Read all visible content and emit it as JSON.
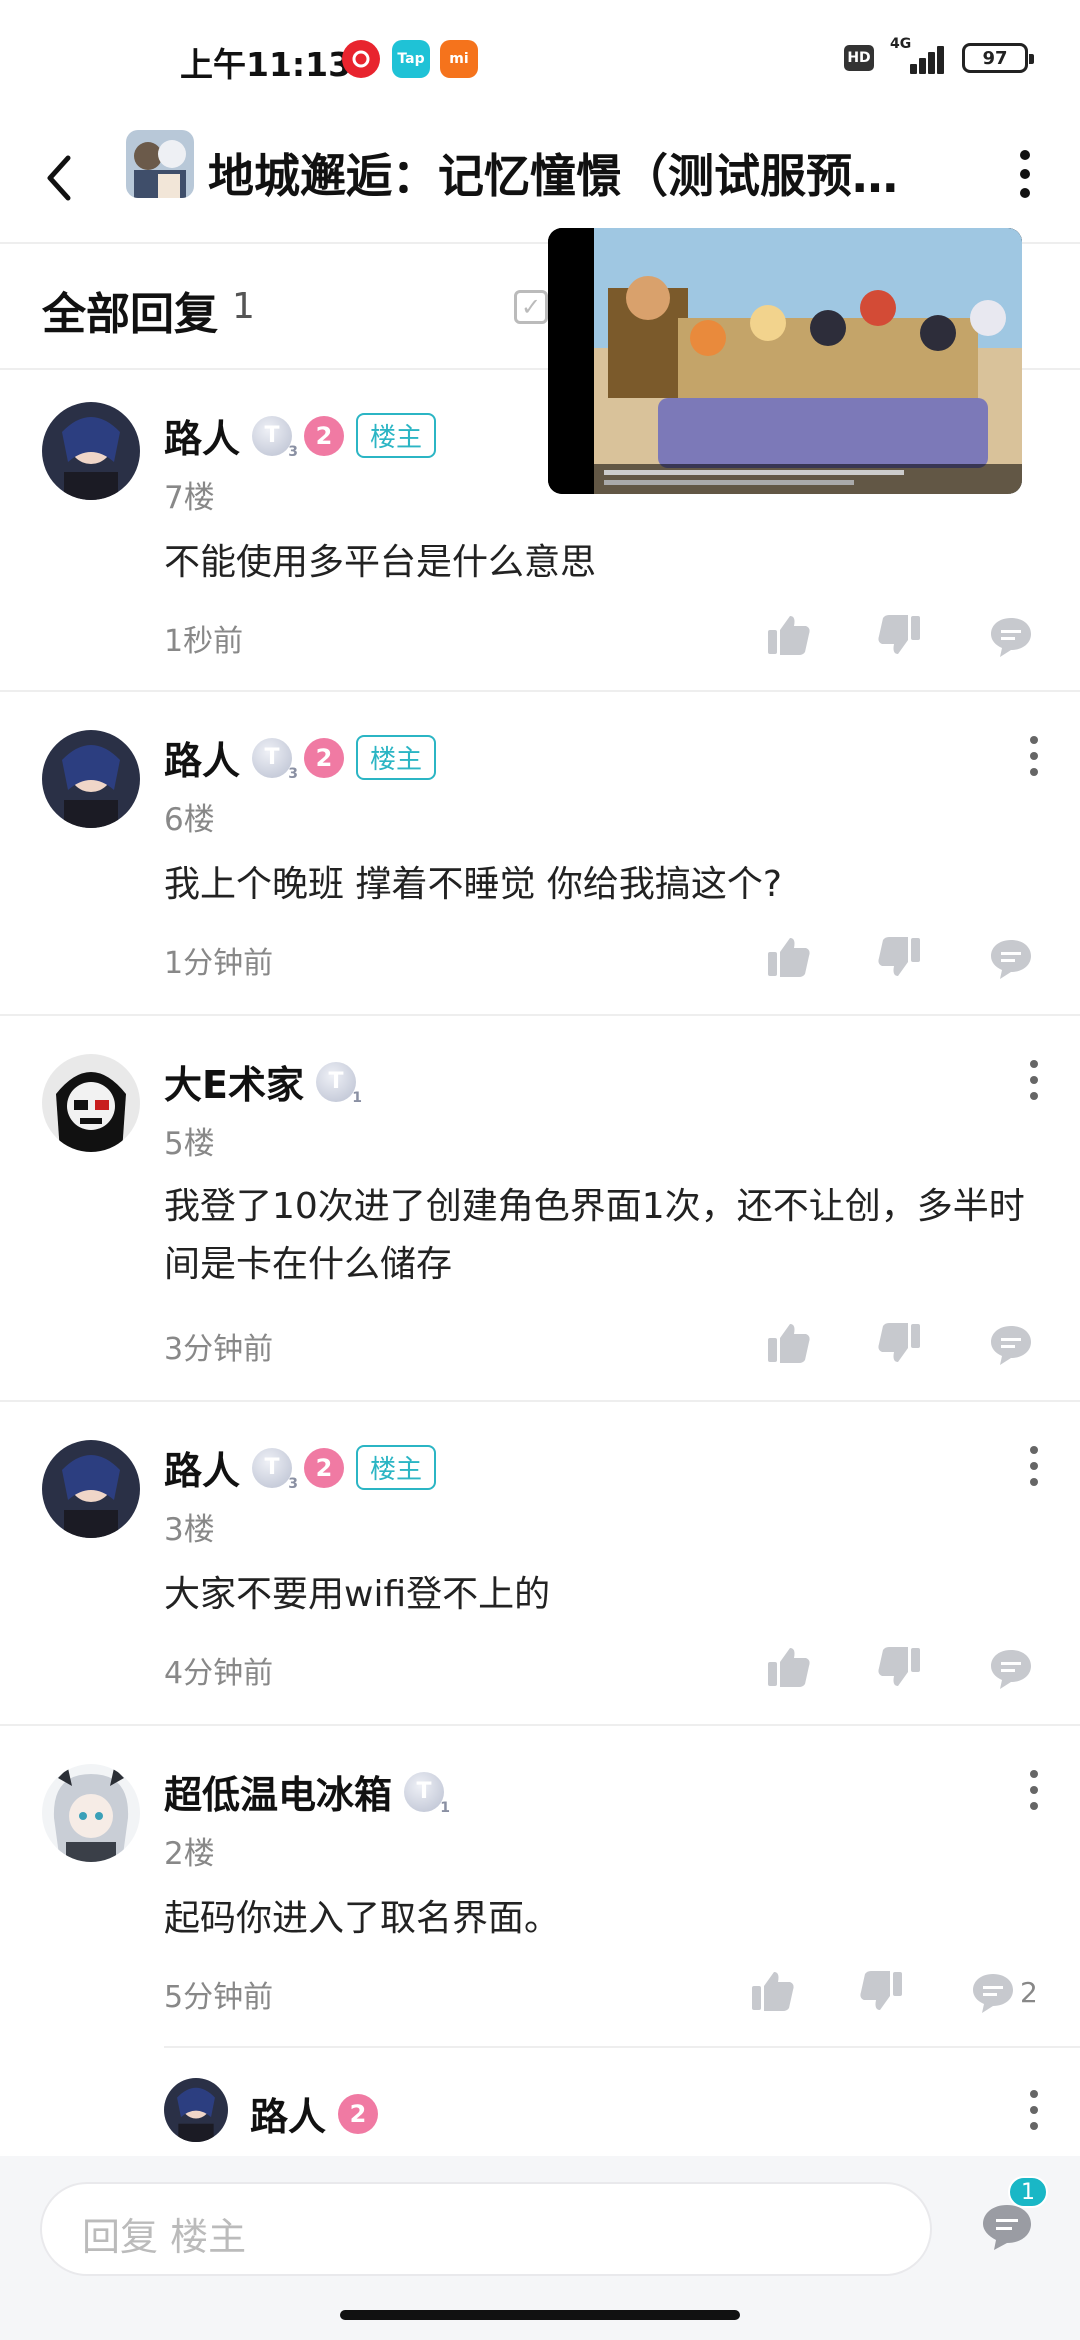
{
  "status_bar": {
    "time": "上午11:13",
    "apps": [
      "netease-music-icon",
      "taptap-icon",
      "xiaomi-icon"
    ],
    "tap_label": "Tap",
    "mi_label": "mi",
    "hd_label": "HD",
    "network_label": "4G",
    "battery": "97"
  },
  "header": {
    "title": "地城邂逅：记忆憧憬（测试服预…"
  },
  "section": {
    "title": "全部回复",
    "count": "1"
  },
  "comments": [
    {
      "name": "路人",
      "level": "T",
      "level_sub": "3",
      "owner_label": "楼主",
      "floor": "7楼",
      "text": "不能使用多平台是什么意思",
      "time": "1秒前"
    },
    {
      "name": "路人",
      "level": "T",
      "level_sub": "3",
      "owner_label": "楼主",
      "floor": "6楼",
      "text": "我上个晚班 撑着不睡觉 你给我搞这个?",
      "time": "1分钟前"
    },
    {
      "name": "大E术家",
      "level": "T",
      "level_sub": "1",
      "floor": "5楼",
      "text": "我登了10次进了创建角色界面1次，还不让创，多半时间是卡在什么储存",
      "time": "3分钟前"
    },
    {
      "name": "路人",
      "level": "T",
      "level_sub": "3",
      "owner_label": "楼主",
      "floor": "3楼",
      "text": "大家不要用wifi登不上的",
      "time": "4分钟前"
    },
    {
      "name": "超低温电冰箱",
      "level": "T",
      "level_sub": "1",
      "floor": "2楼",
      "text": "起码你进入了取名界面。",
      "time": "5分钟前",
      "reply_count": "2"
    }
  ],
  "sub_reply": {
    "name": "路人"
  },
  "verified_mark": "2",
  "bottom": {
    "reply_placeholder": "回复  楼主",
    "badge": "1"
  },
  "colors": {
    "accent": "#2bb5c4",
    "badge_pink": "#f07aa3",
    "icon_gray": "#c7c9ce"
  }
}
